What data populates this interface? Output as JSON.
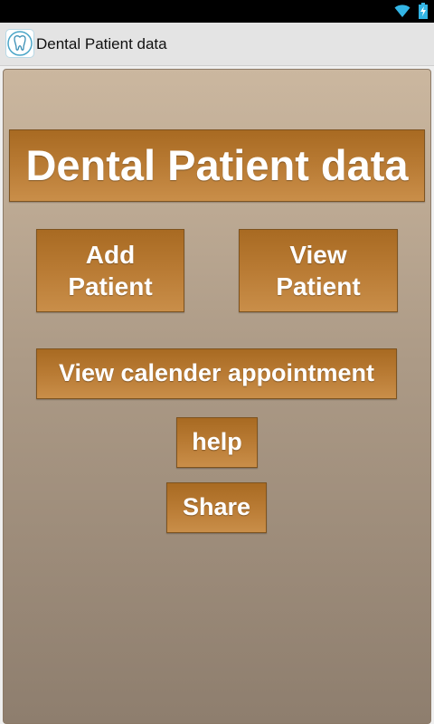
{
  "status_bar": {
    "icons": [
      "wifi-icon",
      "battery-charging-icon"
    ]
  },
  "action_bar": {
    "app_icon": "tooth-icon",
    "title": "Dental Patient data"
  },
  "main": {
    "heading": "Dental Patient data",
    "buttons": {
      "add_patient": "Add\nPatient",
      "view_patient": "View\nPatient",
      "view_calendar": "View calender appointment",
      "help": "help",
      "share": "Share"
    }
  },
  "colors": {
    "button_fill": "#b97b34",
    "button_text": "#ffffff",
    "background_top": "#cbb79f",
    "background_bottom": "#8e7e6e",
    "status_bar": "#000000",
    "action_bar": "#e4e4e4",
    "status_icons": "#33b5e5"
  }
}
